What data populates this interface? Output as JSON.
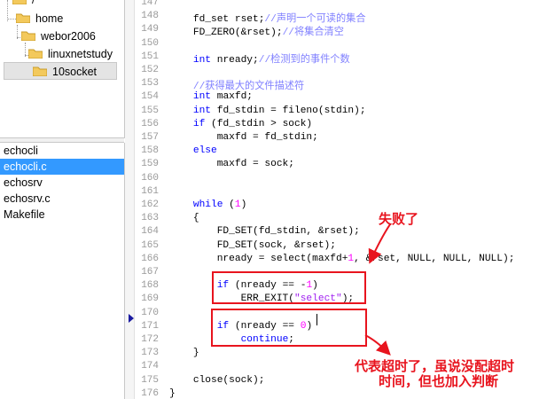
{
  "tree": {
    "root_label": "/",
    "nodes": [
      {
        "label": "home"
      },
      {
        "label": "webor2006"
      },
      {
        "label": "linuxnetstudy"
      },
      {
        "label": "10socket"
      }
    ]
  },
  "files": [
    "echocli",
    "echocli.c",
    "echosrv",
    "echosrv.c",
    "Makefile"
  ],
  "selected_file": "echocli.c",
  "editor": {
    "lines": [
      {
        "n": "147",
        "segs": []
      },
      {
        "n": "148",
        "segs": [
          {
            "t": "    fd_set rset;"
          },
          {
            "t": "//声明一个可读的集合",
            "c": "cm"
          }
        ]
      },
      {
        "n": "149",
        "segs": [
          {
            "t": "    FD_ZERO(&rset);"
          },
          {
            "t": "//将集合清空",
            "c": "cm"
          }
        ]
      },
      {
        "n": "150",
        "segs": []
      },
      {
        "n": "151",
        "segs": [
          {
            "t": "    "
          },
          {
            "t": "int",
            "c": "kw"
          },
          {
            "t": " nready;"
          },
          {
            "t": "//检测到的事件个数",
            "c": "cm"
          }
        ]
      },
      {
        "n": "152",
        "segs": []
      },
      {
        "n": "153",
        "segs": [
          {
            "t": "    "
          },
          {
            "t": "//获得最大的文件描述符",
            "c": "cm"
          }
        ]
      },
      {
        "n": "154",
        "segs": [
          {
            "t": "    "
          },
          {
            "t": "int",
            "c": "kw"
          },
          {
            "t": " maxfd;"
          }
        ]
      },
      {
        "n": "155",
        "segs": [
          {
            "t": "    "
          },
          {
            "t": "int",
            "c": "kw"
          },
          {
            "t": " fd_stdin = fileno(stdin);"
          }
        ]
      },
      {
        "n": "156",
        "segs": [
          {
            "t": "    "
          },
          {
            "t": "if",
            "c": "kw"
          },
          {
            "t": " (fd_stdin > sock)"
          }
        ]
      },
      {
        "n": "157",
        "segs": [
          {
            "t": "        maxfd = fd_stdin;"
          }
        ]
      },
      {
        "n": "158",
        "segs": [
          {
            "t": "    "
          },
          {
            "t": "else",
            "c": "kw"
          }
        ]
      },
      {
        "n": "159",
        "segs": [
          {
            "t": "        maxfd = sock;"
          }
        ]
      },
      {
        "n": "160",
        "segs": []
      },
      {
        "n": "161",
        "segs": []
      },
      {
        "n": "162",
        "segs": [
          {
            "t": "    "
          },
          {
            "t": "while",
            "c": "kw"
          },
          {
            "t": " ("
          },
          {
            "t": "1",
            "c": "num"
          },
          {
            "t": ")"
          }
        ]
      },
      {
        "n": "163",
        "segs": [
          {
            "t": "    {"
          }
        ]
      },
      {
        "n": "164",
        "segs": [
          {
            "t": "        FD_SET(fd_stdin, &rset);"
          }
        ]
      },
      {
        "n": "165",
        "segs": [
          {
            "t": "        FD_SET(sock, &rset);"
          }
        ]
      },
      {
        "n": "166",
        "segs": [
          {
            "t": "        nready = select(maxfd+"
          },
          {
            "t": "1",
            "c": "num"
          },
          {
            "t": ", &rset, NULL, NULL, NULL);"
          }
        ]
      },
      {
        "n": "167",
        "segs": []
      },
      {
        "n": "168",
        "segs": [
          {
            "t": "        "
          },
          {
            "t": "if",
            "c": "kw"
          },
          {
            "t": " (nready == -"
          },
          {
            "t": "1",
            "c": "num"
          },
          {
            "t": ")"
          }
        ]
      },
      {
        "n": "169",
        "segs": [
          {
            "t": "            ERR_EXIT("
          },
          {
            "t": "\"select\"",
            "c": "st"
          },
          {
            "t": ");"
          }
        ]
      },
      {
        "n": "170",
        "segs": []
      },
      {
        "n": "171",
        "segs": [
          {
            "t": "        "
          },
          {
            "t": "if",
            "c": "kw"
          },
          {
            "t": " (nready == "
          },
          {
            "t": "0",
            "c": "num"
          },
          {
            "t": ")"
          }
        ]
      },
      {
        "n": "172",
        "segs": [
          {
            "t": "            "
          },
          {
            "t": "continue",
            "c": "kw"
          },
          {
            "t": ";"
          }
        ]
      },
      {
        "n": "173",
        "segs": [
          {
            "t": "    }"
          }
        ]
      },
      {
        "n": "174",
        "segs": []
      },
      {
        "n": "175",
        "segs": [
          {
            "t": "    close(sock);"
          }
        ]
      },
      {
        "n": "176",
        "segs": [
          {
            "t": "}"
          }
        ]
      }
    ]
  },
  "annotations": {
    "failed": "失败了",
    "timeout_line1": "代表超时了，虽说没配超时",
    "timeout_line2": "时间，但也加入判断",
    "color": "#e8141e"
  }
}
